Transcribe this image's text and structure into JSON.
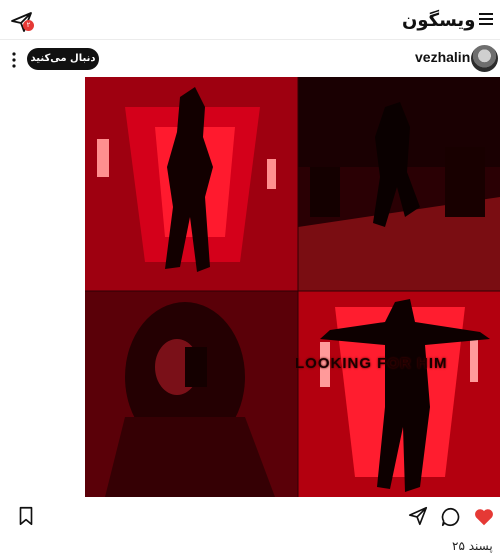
{
  "header": {
    "brand": "ویسگون",
    "notification_count": "۲",
    "icons": [
      "paper-plane-icon",
      "hamburger-menu-icon"
    ]
  },
  "post": {
    "username": "vezhalin",
    "follow_label": "دنبال می‌کنید",
    "image_overlay_text": "LOOKING FOR HIM",
    "likes_label": "۲۵ پسند",
    "colors": {
      "accent_red": "#e53935",
      "image_red": "#c0000d"
    },
    "icons": [
      "more-vertical-icon",
      "heart-icon",
      "comment-icon",
      "share-icon",
      "bookmark-icon"
    ]
  }
}
